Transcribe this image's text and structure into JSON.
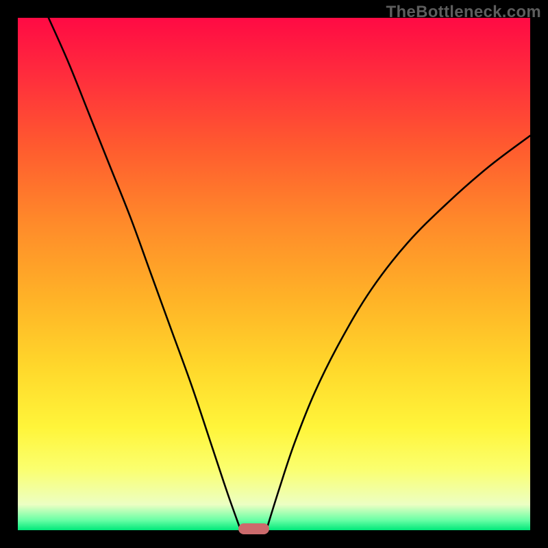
{
  "watermark": "TheBottleneck.com",
  "colors": {
    "frame": "#000000",
    "gradient_top": "#ff0a44",
    "gradient_bottom": "#00e87a",
    "curve": "#000000",
    "marker": "#cc6a6c",
    "watermark_text": "#5d5d5d"
  },
  "chart_data": {
    "type": "line",
    "title": "",
    "xlabel": "",
    "ylabel": "",
    "xlim": [
      0,
      100
    ],
    "ylim": [
      0,
      100
    ],
    "grid": false,
    "description": "Bottleneck curve: two branches descending to a minimum near x≈45 where bottleneck ≈0, rising steeply on both sides. Color gradient encodes bottleneck severity (red=high, green=low).",
    "series": [
      {
        "name": "left-branch",
        "x": [
          6,
          10,
          14,
          18,
          22,
          26,
          30,
          34,
          38,
          41,
          43.5
        ],
        "y": [
          100,
          91,
          81,
          71,
          61,
          50,
          39,
          28,
          16,
          7,
          0
        ]
      },
      {
        "name": "right-branch",
        "x": [
          48.5,
          51,
          54,
          58,
          63,
          69,
          76,
          84,
          92,
          100
        ],
        "y": [
          0,
          8,
          17,
          27,
          37,
          47,
          56,
          64,
          71,
          77
        ]
      }
    ],
    "marker": {
      "x_center": 46,
      "y": 0,
      "width_pct": 6
    }
  }
}
